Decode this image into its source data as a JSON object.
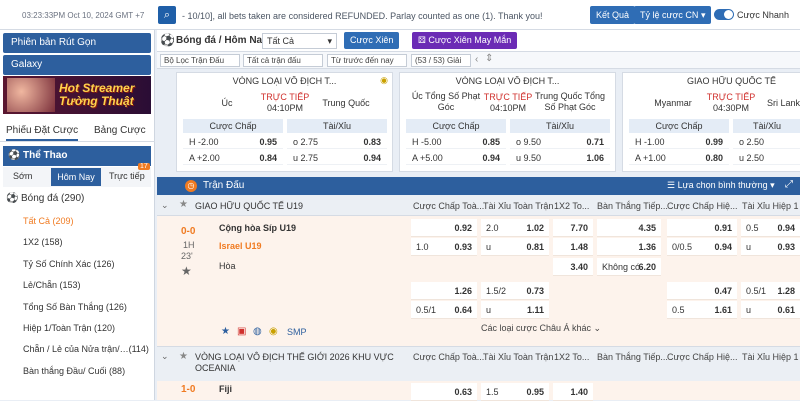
{
  "topbar": {
    "clock": "03:23:33PM Oct 10, 2024 GMT +7",
    "ticker": "- 10/10], all bets taken are considered REFUNDED. Parlay counted as one (1). Thank you!",
    "result_btn": "Kết Quả",
    "odds_type": "Tỷ lệ cược CN",
    "quick_bet": "Cược Nhanh"
  },
  "sidebar": {
    "withdraw": "Phiên bản Rút Gọn",
    "galaxy": "Galaxy",
    "banner": "Hot Streamer Tường Thuật",
    "tabs": [
      "Phiếu Đặt Cược",
      "Bảng Cược"
    ],
    "sport_header": "Thể Thao",
    "subtabs": [
      "Sớm",
      "Hôm Nay",
      "Trực tiếp"
    ],
    "live_count": "17",
    "items": [
      {
        "label": "Bóng đá (290)"
      },
      {
        "label": "Tất Cả (209)"
      },
      {
        "label": "1X2 (158)"
      },
      {
        "label": "Tỷ Số Chính Xác (126)"
      },
      {
        "label": "Lẻ/Chẵn (153)"
      },
      {
        "label": "Tổng Số Bàn Thắng (126)"
      },
      {
        "label": "Hiệp 1/Toàn Trận (120)"
      },
      {
        "label": "Chẵn / Lẻ của Nửa trận/…(114)"
      },
      {
        "label": "Bàn thắng Đầu/ Cuối (88)"
      }
    ]
  },
  "header": {
    "title": "Bóng đá / Hôm Nay",
    "select": "Tất Cả",
    "parlay": "Cược Xiên",
    "lucky_parlay": "Cược Xiên May Mắn",
    "filters": [
      "Bộ Lọc Trận Đấu",
      "Tất cả trận đấu",
      "Từ trước đến nay",
      "(53 / 53) Giải"
    ]
  },
  "cards": [
    {
      "league": "VÒNG LOẠI VÔ ĐỊCH T...",
      "home": "Úc",
      "away": "Trung Quốc",
      "live": "TRỰC TIẾP",
      "time": "04:10PM",
      "h1": "Cược Chấp",
      "h2": "Tài/Xỉu",
      "rows": [
        [
          "H -2.00",
          "0.95",
          "o 2.75",
          "0.83"
        ],
        [
          "A +2.00",
          "0.84",
          "u 2.75",
          "0.94"
        ]
      ]
    },
    {
      "league": "VÒNG LOẠI VÔ ĐỊCH T...",
      "home": "Úc Tổng Số Phạt Góc",
      "away": "Trung Quốc Tổng Số Phạt Góc",
      "live": "TRỰC TIẾP",
      "time": "04:10PM",
      "h1": "Cược Chấp",
      "h2": "Tài/Xỉu",
      "rows": [
        [
          "H -5.00",
          "0.85",
          "o 9.50",
          "0.71"
        ],
        [
          "A +5.00",
          "0.94",
          "u 9.50",
          "1.06"
        ]
      ]
    },
    {
      "league": "GIAO HỮU QUỐC TẾ",
      "home": "Myanmar",
      "away": "Sri Lanka",
      "live": "TRỰC TIẾP",
      "time": "04:30PM",
      "h1": "Cược Chấp",
      "h2": "Tài/Xỉu",
      "rows": [
        [
          "H -1.00",
          "0.99",
          "o 2.50",
          ""
        ],
        [
          "A +1.00",
          "0.80",
          "u 2.50",
          ""
        ]
      ]
    }
  ],
  "section": {
    "title": "Trận Đấu",
    "sort": "Lựa chọn bình thường"
  },
  "columns": [
    "Cược Chấp Toà...",
    "Tài Xỉu Toàn Trận",
    "1X2 To...",
    "Bàn Thắng Tiếp...",
    "Cược Chấp Hiệ...",
    "Tài Xỉu Hiệp 1"
  ],
  "match1": {
    "league": "GIAO HỮU QUỐC TẾ U19",
    "score": "0-0",
    "period": "1H",
    "minute": "23'",
    "home": "Cộng hòa Síp U19",
    "away": "Israel U19",
    "draw": "Hòa",
    "more": "Các loại cược Châu Á khác",
    "r1": {
      "hdp": "0.92",
      "ou_line": "2.0",
      "ou": "1.02",
      "x12": "7.70",
      "next": "4.35",
      "hhdp": "0.91",
      "hou_line": "0.5",
      "hou": "0.94"
    },
    "r2": {
      "hdp_line": "1.0",
      "hdp": "0.93",
      "ou_line": "u",
      "ou": "0.81",
      "x12": "1.48",
      "next": "1.36",
      "hhdp_line": "0/0.5",
      "hhdp": "0.94",
      "hou_line": "u",
      "hou": "0.93"
    },
    "r3": {
      "x12": "3.40",
      "next_label": "Không có",
      "next": "6.20"
    },
    "r4": {
      "hdp": "1.26",
      "ou_line": "1.5/2",
      "ou": "0.73",
      "hhdp": "0.47",
      "hou_line": "0.5/1",
      "hou": "1.28"
    },
    "r5": {
      "hdp_line": "0.5/1",
      "hdp": "0.64",
      "ou_line": "u",
      "ou": "1.11",
      "hhdp_line": "0.5",
      "hhdp": "1.61",
      "hou_line": "u",
      "hou": "0.61"
    },
    "smp": "SMP"
  },
  "league2": {
    "title": "VÒNG LOẠI VÔ ĐỊCH THẾ GIỚI 2026 KHU VỰC OCEANIA",
    "row": [
      "0.63",
      "1.5",
      "0.95",
      "1.40"
    ],
    "home": "Fiji",
    "score": "1-0"
  }
}
